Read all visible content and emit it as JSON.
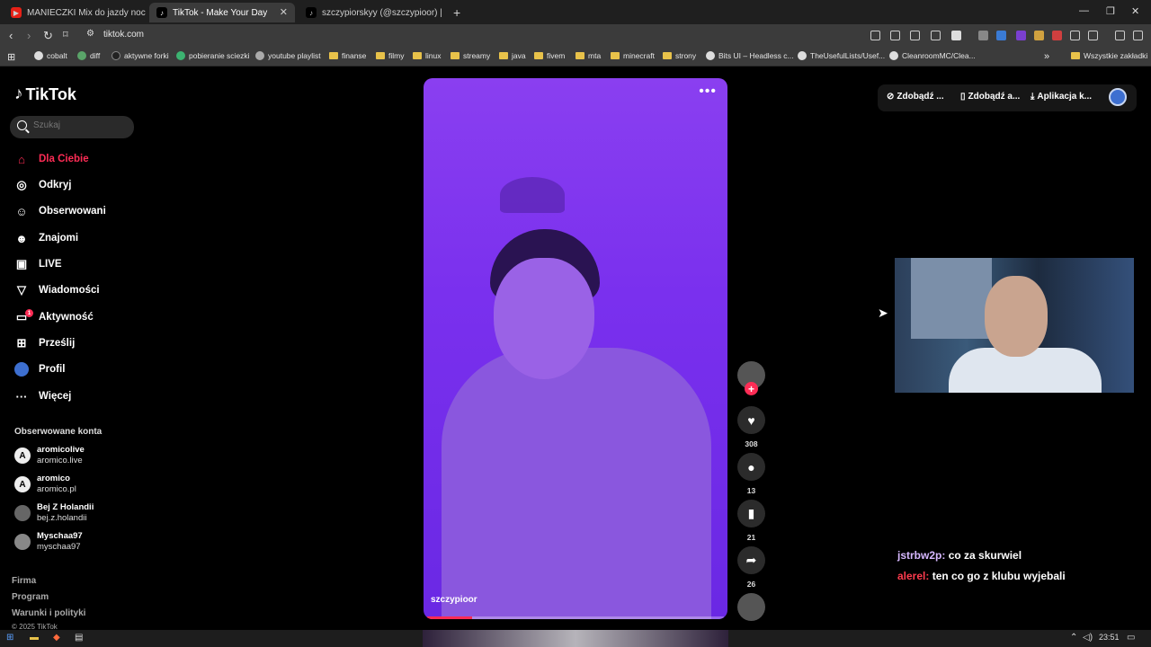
{
  "browser": {
    "tabs": [
      {
        "label": "MANIECZKI Mix do jazdy nocą w",
        "active": false
      },
      {
        "label": "TikTok - Make Your Day",
        "active": true
      },
      {
        "label": "szczypiorskyy (@szczypioor) | TikTok",
        "active": false
      }
    ],
    "new_tab": "+",
    "url": "tiktok.com",
    "bookmarks": [
      "cobalt",
      "diff",
      "aktywne forki",
      "pobieranie sciezki",
      "youtube playlist",
      "finanse",
      "filmy",
      "linux",
      "streamy",
      "java",
      "fivem",
      "mta",
      "minecraft",
      "strony",
      "Bits UI – Headless c...",
      "TheUsefulLists/Usef...",
      "CleanroomMC/Clea..."
    ],
    "bookmarks_more": "»",
    "all_bookmarks": "Wszystkie zakładki"
  },
  "tiktok": {
    "logo": "TikTok",
    "search_placeholder": "Szukaj",
    "nav": [
      {
        "label": "Dla Ciebie",
        "icon": "home-icon"
      },
      {
        "label": "Odkryj",
        "icon": "compass-icon"
      },
      {
        "label": "Obserwowani",
        "icon": "following-icon"
      },
      {
        "label": "Znajomi",
        "icon": "friends-icon"
      },
      {
        "label": "LIVE",
        "icon": "live-icon"
      },
      {
        "label": "Wiadomości",
        "icon": "messages-icon"
      },
      {
        "label": "Aktywność",
        "icon": "activity-icon",
        "badge": "1"
      },
      {
        "label": "Prześlij",
        "icon": "upload-icon"
      },
      {
        "label": "Profil",
        "icon": "profile-icon"
      },
      {
        "label": "Więcej",
        "icon": "more-icon"
      }
    ],
    "followed_title": "Obserwowane konta",
    "followed": [
      {
        "name": "aromicolive",
        "handle": "aromico.live"
      },
      {
        "name": "aromico",
        "handle": "aromico.pl"
      },
      {
        "name": "Bej Z Holandii",
        "handle": "bej.z.holandii"
      },
      {
        "name": "Myschaa97",
        "handle": "myschaa97"
      }
    ],
    "footer": [
      "Firma",
      "Program",
      "Warunki i polityki",
      "© 2025 TikTok"
    ],
    "video": {
      "author": "szczypioor",
      "more": "•••",
      "progress": 0.15
    },
    "actions": {
      "likes": "308",
      "comments": "13",
      "saves": "21",
      "shares": "26"
    },
    "topbar": [
      "Zdobądź ...",
      "Zdobądź a...",
      "Aplikacja k..."
    ]
  },
  "chat": [
    {
      "user": "jstrbw2p:",
      "message": "co za skurwiel",
      "color": "#d7b8ff"
    },
    {
      "user": "alerel:",
      "message": "ten co go z klubu wyjebali",
      "color": "#ff3b4e"
    }
  ],
  "taskbar": {
    "time": "23:51"
  }
}
